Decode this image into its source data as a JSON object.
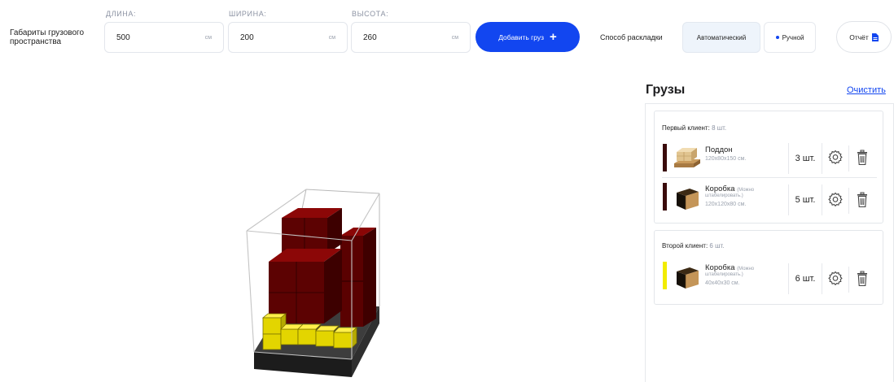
{
  "dimensions": {
    "title": "Габариты грузового пространства",
    "length": {
      "label": "ДЛИНА:",
      "value": "500",
      "unit": "см"
    },
    "width": {
      "label": "ШИРИНА:",
      "value": "200",
      "unit": "см"
    },
    "height": {
      "label": "ВЫСОТА:",
      "value": "260",
      "unit": "см"
    }
  },
  "add_button": {
    "label": "Добавить груз",
    "icon": "plus-icon"
  },
  "layout_mode": {
    "label": "Способ раскладки",
    "options": [
      "Автоматический",
      "Ручной"
    ],
    "selected": "Автоматический"
  },
  "report_button": {
    "label": "Отчёт",
    "icon": "document-icon"
  },
  "cargo_panel": {
    "title": "Грузы",
    "clear_label": "Очистить",
    "clients": [
      {
        "name": "Первый клиент:",
        "count": "8 шт.",
        "items": [
          {
            "name": "Поддон",
            "note": "",
            "note2": "",
            "size": "120x80x150 см.",
            "qty": "3 шт.",
            "color": "#3a0b0b",
            "thumb": "pallet"
          },
          {
            "name": "Коробка",
            "note": "(Можно",
            "note2": "штабелировать.)",
            "size": "120x120x80 см.",
            "qty": "5 шт.",
            "color": "#3a0b0b",
            "thumb": "box"
          }
        ]
      },
      {
        "name": "Второй клиент:",
        "count": "6 шт.",
        "items": [
          {
            "name": "Коробка",
            "note": "(Можно",
            "note2": "штабелировать.)",
            "size": "40x40x30 см.",
            "qty": "6 шт.",
            "color": "#f2ec00",
            "thumb": "box"
          }
        ]
      }
    ]
  },
  "colors": {
    "accent": "#1246f0",
    "cargo_client1": "#6b0000",
    "cargo_client2": "#f2e400",
    "floor": "#2a2a2a"
  }
}
